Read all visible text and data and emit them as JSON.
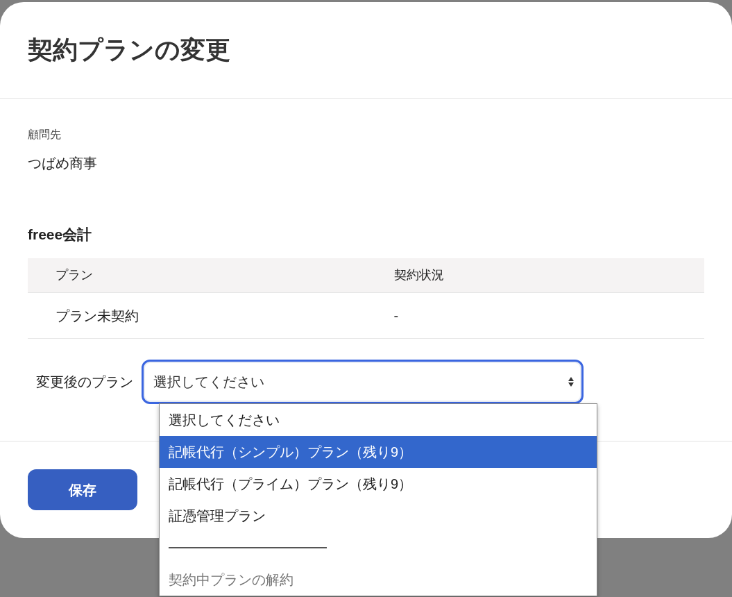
{
  "dialog": {
    "title": "契約プランの変更"
  },
  "client": {
    "label": "顧問先",
    "value": "つばめ商事"
  },
  "service": {
    "title": "freee会計",
    "table": {
      "columns": [
        "プラン",
        "契約状況"
      ],
      "rows": [
        [
          "プラン未契約",
          "-"
        ]
      ]
    }
  },
  "plan_select": {
    "label": "変更後のプラン",
    "value": "選択してください",
    "options": [
      {
        "kind": "option",
        "label": "選択してください",
        "highlighted": false,
        "disabled": false
      },
      {
        "kind": "option",
        "label": "記帳代行（シンプル）プラン（残り9）",
        "highlighted": true,
        "disabled": false
      },
      {
        "kind": "option",
        "label": "記帳代行（プライム）プラン（残り9）",
        "highlighted": false,
        "disabled": false
      },
      {
        "kind": "option",
        "label": "証憑管理プラン",
        "highlighted": false,
        "disabled": false
      },
      {
        "kind": "separator"
      },
      {
        "kind": "option",
        "label": "契約中プランの解約",
        "highlighted": false,
        "disabled": true
      }
    ]
  },
  "buttons": [
    {
      "label": "保存"
    }
  ]
}
